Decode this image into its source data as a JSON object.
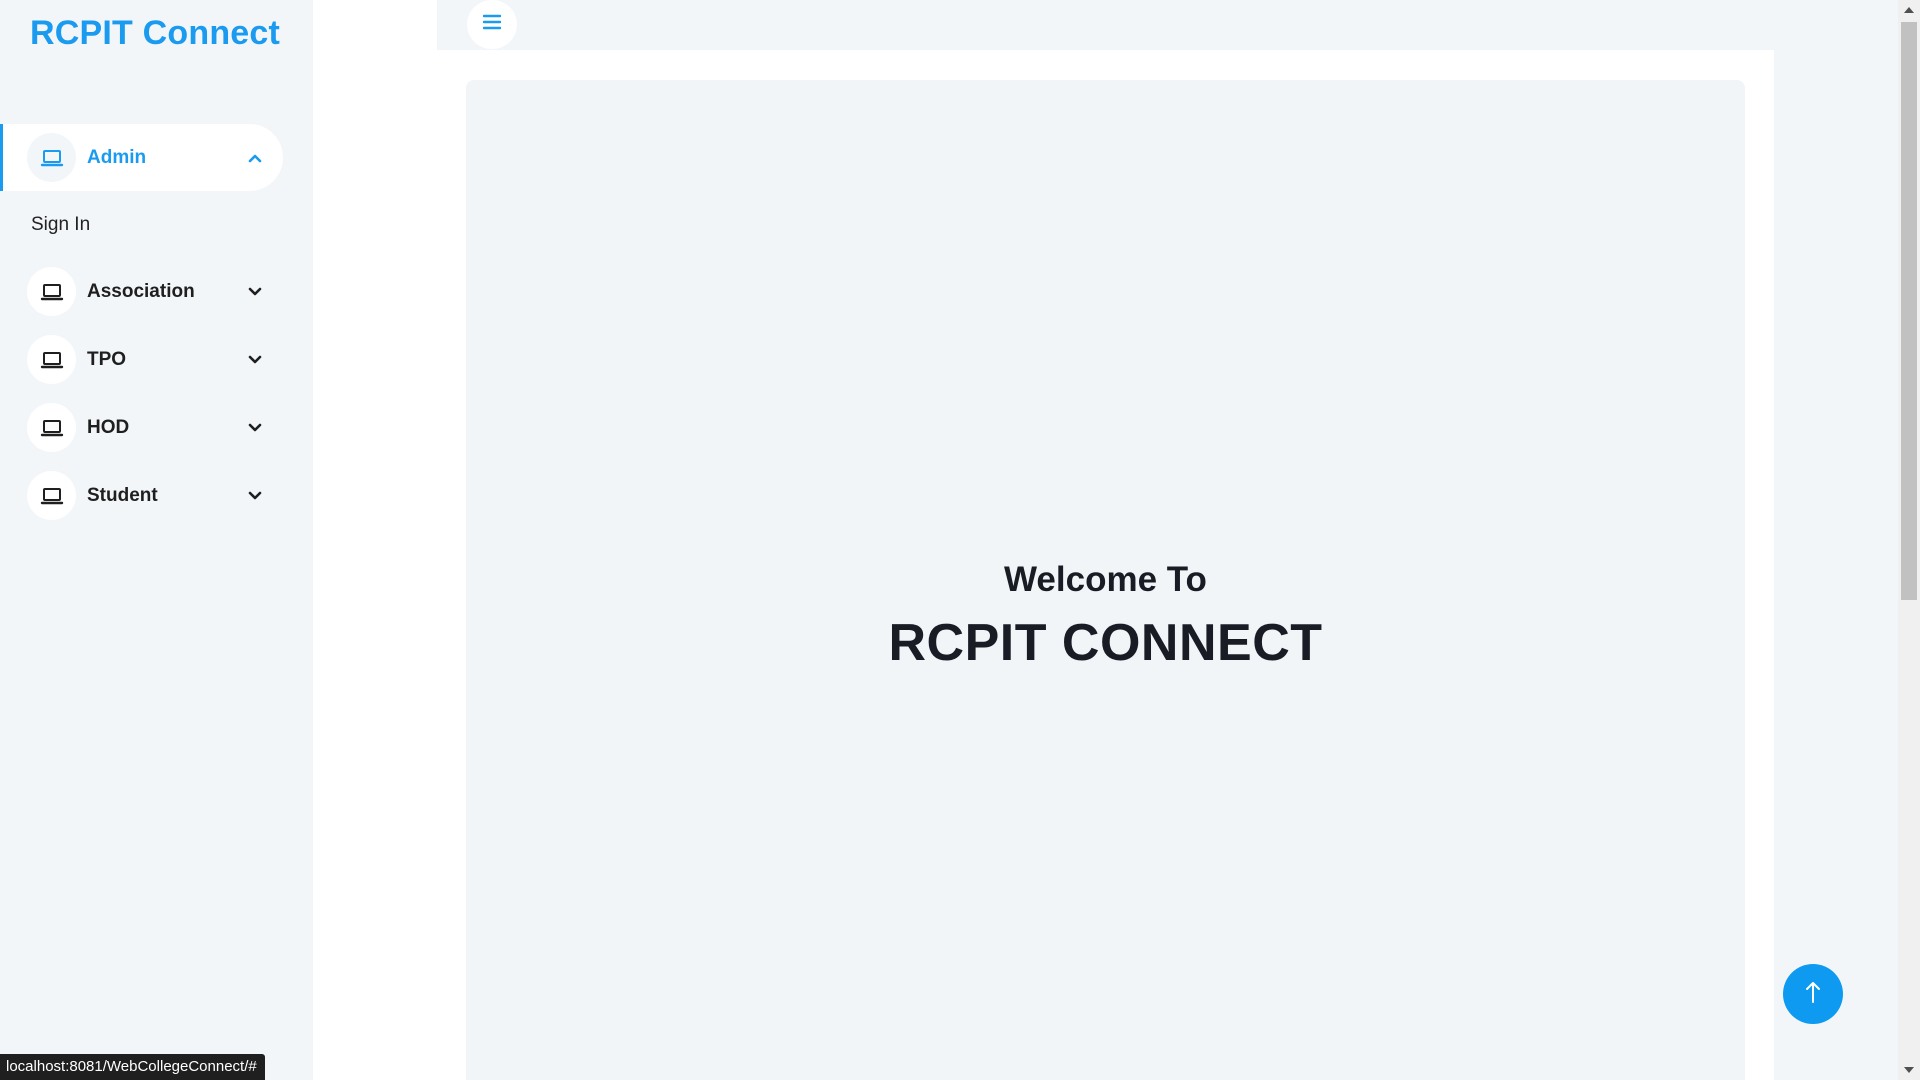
{
  "sidebar": {
    "brand": "RCPIT Connect",
    "items": [
      {
        "label": "Admin",
        "icon": "laptop-icon",
        "expanded": true,
        "sub_items": [
          {
            "label": "Sign In"
          }
        ]
      },
      {
        "label": "Association",
        "icon": "laptop-icon",
        "expanded": false
      },
      {
        "label": "TPO",
        "icon": "laptop-icon",
        "expanded": false
      },
      {
        "label": "HOD",
        "icon": "laptop-icon",
        "expanded": false
      },
      {
        "label": "Student",
        "icon": "laptop-icon",
        "expanded": false
      }
    ]
  },
  "topbar": {
    "toggle_icon": "menu-icon"
  },
  "main": {
    "welcome_subtitle": "Welcome To",
    "welcome_title": "RCPIT CONNECT"
  },
  "scroll_top_icon": "arrow-up-icon",
  "status_bar": {
    "url": "localhost:8081/WebCollegeConnect/#"
  },
  "colors": {
    "accent": "#1a9bf0",
    "sidebar_bg": "#f3f6f9",
    "panel_bg": "#f2f5f8",
    "heading": "#191c24"
  }
}
